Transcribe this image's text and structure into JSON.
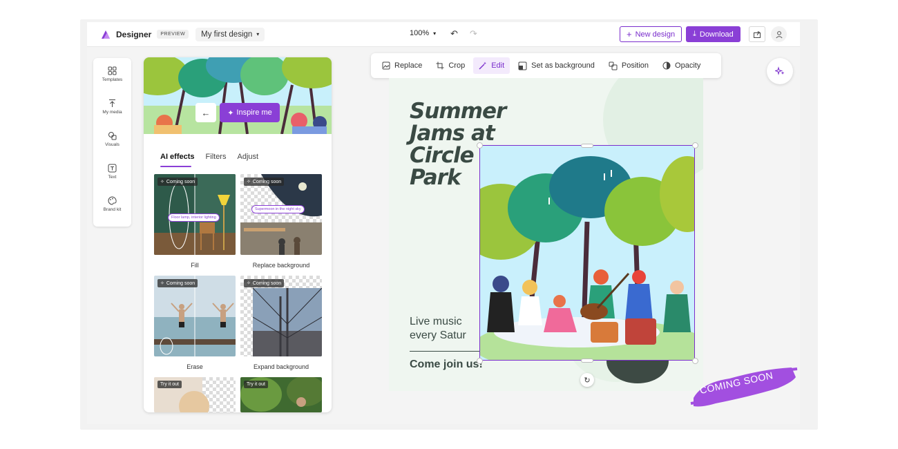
{
  "app": {
    "brand": "Designer",
    "preview_label": "PREVIEW",
    "design_name": "My first design",
    "zoom": "100%",
    "new_design_label": "New design",
    "download_label": "Download",
    "accent_color": "#8a3fd6"
  },
  "rail": {
    "items": [
      {
        "label": "Templates",
        "icon": "templates-icon"
      },
      {
        "label": "My media",
        "icon": "upload-icon"
      },
      {
        "label": "Visuals",
        "icon": "shapes-icon"
      },
      {
        "label": "Text",
        "icon": "text-icon"
      },
      {
        "label": "Brand kit",
        "icon": "palette-icon"
      }
    ]
  },
  "panel": {
    "inspire_label": "Inspire me",
    "tabs": [
      {
        "label": "AI effects",
        "active": true
      },
      {
        "label": "Filters",
        "active": false
      },
      {
        "label": "Adjust",
        "active": false
      }
    ],
    "cards": [
      {
        "caption": "Fill",
        "badge": "Coming soon",
        "tip": "Floor lamp, interior lighting"
      },
      {
        "caption": "Replace background",
        "badge": "Coming soon",
        "tip": "Supermoon in the night sky"
      },
      {
        "caption": "Erase",
        "badge": "Coming soon"
      },
      {
        "caption": "Expand background",
        "badge": "Coming soon"
      },
      {
        "caption": "",
        "badge": "Try it out"
      },
      {
        "caption": "",
        "badge": "Try it out"
      }
    ]
  },
  "toolbar": {
    "tools": [
      {
        "label": "Replace",
        "icon": "image-icon",
        "active": false
      },
      {
        "label": "Crop",
        "icon": "crop-icon",
        "active": false
      },
      {
        "label": "Edit",
        "icon": "magic-wand-icon",
        "active": true
      },
      {
        "label": "Set as background",
        "icon": "background-icon",
        "active": false
      },
      {
        "label": "Position",
        "icon": "position-icon",
        "active": false
      },
      {
        "label": "Opacity",
        "icon": "opacity-icon",
        "active": false
      }
    ]
  },
  "canvas": {
    "headline": [
      "Summer",
      "Jams at",
      "Circle",
      "Park"
    ],
    "live_lines": [
      "Live music",
      "every Satur"
    ],
    "join": "Come join us!"
  },
  "stamp": "COMING SOON"
}
